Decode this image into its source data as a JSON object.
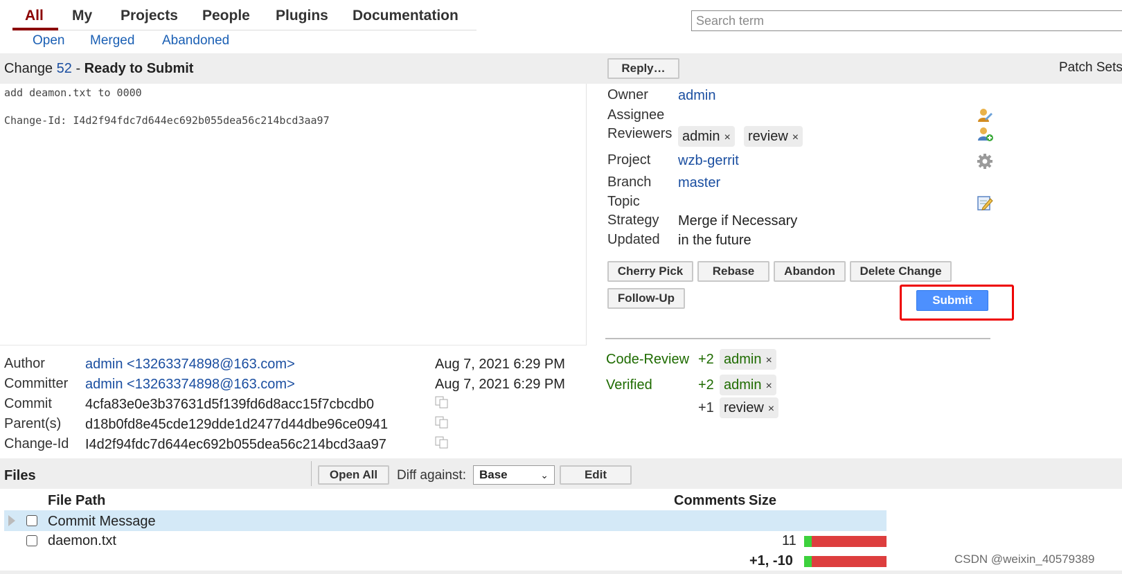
{
  "nav": {
    "tabs": [
      "All",
      "My",
      "Projects",
      "People",
      "Plugins",
      "Documentation"
    ],
    "sub": [
      "Open",
      "Merged",
      "Abandoned"
    ]
  },
  "search": {
    "placeholder": "Search term"
  },
  "change": {
    "label": "Change",
    "number": "52",
    "dash": "-",
    "status": "Ready to Submit",
    "reply_label": "Reply…",
    "patch_sets_label": "Patch Sets"
  },
  "commit_message": {
    "line1": "add deamon.txt to 0000",
    "line2": "Change-Id: I4d2f94fdc7d644ec692b055dea56c214bcd3aa97"
  },
  "info": {
    "owner_label": "Owner",
    "owner": "admin",
    "assignee_label": "Assignee",
    "reviewers_label": "Reviewers",
    "reviewers": [
      "admin",
      "review"
    ],
    "remove_glyph": "×",
    "project_label": "Project",
    "project": "wzb-gerrit",
    "branch_label": "Branch",
    "branch": "master",
    "topic_label": "Topic",
    "strategy_label": "Strategy",
    "strategy": "Merge if Necessary",
    "updated_label": "Updated",
    "updated": "in the future"
  },
  "actions": {
    "cherry_pick": "Cherry Pick",
    "rebase": "Rebase",
    "abandon": "Abandon",
    "delete_change": "Delete Change",
    "follow_up": "Follow-Up",
    "submit": "Submit"
  },
  "labels": {
    "code_review": "Code-Review",
    "verified": "Verified",
    "votes": [
      {
        "score": "+2",
        "user": "admin"
      },
      {
        "score": "+2",
        "user": "admin"
      },
      {
        "score": "+1",
        "user": "review"
      }
    ]
  },
  "people": {
    "author_label": "Author",
    "author": "admin <13263374898@163.com>",
    "author_date": "Aug 7, 2021 6:29 PM",
    "committer_label": "Committer",
    "committer": "admin <13263374898@163.com>",
    "committer_date": "Aug 7, 2021 6:29 PM",
    "commit_label": "Commit",
    "commit": "4cfa83e0e3b37631d5f139fd6d8acc15f7cbcdb0",
    "parent_label": "Parent(s)",
    "parent": "d18b0fd8e45cde129dde1d2477d44dbe96ce0941",
    "changeid_label": "Change-Id",
    "changeid": "I4d2f94fdc7d644ec692b055dea56c214bcd3aa97"
  },
  "files": {
    "title": "Files",
    "open_all": "Open All",
    "diff_against_label": "Diff against:",
    "diff_against_value": "Base",
    "edit": "Edit",
    "columns": {
      "path": "File Path",
      "comments": "Comments",
      "size": "Size"
    },
    "rows": [
      {
        "path": "Commit Message",
        "size": ""
      },
      {
        "path": "daemon.txt",
        "size": "11"
      }
    ],
    "total": "+1, -10"
  },
  "watermark": "CSDN @weixin_40579389",
  "colors": {
    "active_tab": "#8b0000",
    "link": "#1a4ea0",
    "submit": "#4d90fe",
    "highlight_box": "#e00000",
    "vote_green": "#1e6b00",
    "bar_added": "#3dd13d",
    "bar_removed": "#dd3e3e"
  }
}
